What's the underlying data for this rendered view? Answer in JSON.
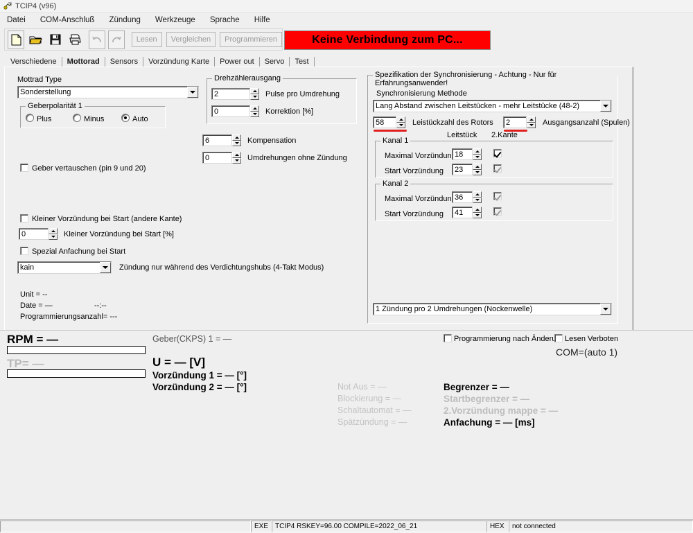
{
  "window": {
    "title": "TCIP4 (v96)",
    "icon": "app-icon"
  },
  "menu": [
    "Datei",
    "COM-Anschluß",
    "Zündung",
    "Werkzeuge",
    "Sprache",
    "Hilfe"
  ],
  "toolbar": {
    "icons": [
      "new-file-icon",
      "open-folder-icon",
      "save-floppy-icon",
      "print-icon",
      "undo-icon",
      "redo-icon"
    ],
    "buttons": [
      {
        "label": "Lesen",
        "enabled": false
      },
      {
        "label": "Vergleichen",
        "enabled": false
      },
      {
        "label": "Programmieren",
        "enabled": false
      }
    ]
  },
  "banner": {
    "text": "Keine Verbindung zum PC...",
    "bg": "#ff0000",
    "fg": "#000000"
  },
  "tabs": [
    {
      "label": "Verschiedene",
      "active": false
    },
    {
      "label": "Mottorad",
      "active": true
    },
    {
      "label": "Sensors",
      "active": false
    },
    {
      "label": "Vorzündung Karte",
      "active": false
    },
    {
      "label": "Power out",
      "active": false
    },
    {
      "label": "Servo",
      "active": false
    },
    {
      "label": "Test",
      "active": false
    }
  ],
  "motorrad": {
    "type_label": "Mottrad Type",
    "type_value": "Sonderstellung",
    "geberpolaritaet": {
      "legend": "Geberpolarität 1",
      "options": [
        "Plus",
        "Minus",
        "Auto"
      ],
      "selected": "Auto"
    },
    "geber_vertauschen": {
      "label": "Geber vertauschen (pin 9 und 20)",
      "checked": false
    },
    "drehzaehler": {
      "legend": "Drehzählerausgang",
      "pulse_value": "2",
      "pulse_label": "Pulse pro Umdrehung",
      "korrektur_value": "0",
      "korrektur_label": "Korrektion [%]"
    },
    "kompensation": {
      "value": "6",
      "label": "Kompensation"
    },
    "umdrehungen": {
      "value": "0",
      "label": "Umdrehungen ohne Zündung"
    },
    "kleiner_vorz_kante": {
      "label": "Kleiner Vorzündung bei Start (andere Kante)",
      "checked": false
    },
    "kleiner_vorz_pct": {
      "value": "0",
      "label": "Kleiner Vorzündung bei Start [%]"
    },
    "spezial_anfachung": {
      "label": "Spezial Anfachung bei Start",
      "checked": false
    },
    "takt_combo_value": "kain",
    "takt_combo_label": "Zündung nur während des Verdichtungshubs (4-Takt Modus)",
    "info": {
      "unit": "Unit = --",
      "date": "Date = —",
      "time": "--:--",
      "prog_count": "Programmierungsanzahl= ---"
    }
  },
  "sync": {
    "legend": "Spezifikation der Synchronisierung - Achtung - Nur für Erfahrungsanwender!",
    "method_label": "Synchronisierung Methode",
    "method_value": "Lang Abstand zwischen Leitstücken - mehr Leitstücke (48-2)",
    "rotor": {
      "value": "58",
      "label": "Leistückzahl des Rotors",
      "marked": true
    },
    "outputs": {
      "value": "2",
      "label": "Ausgangsanzahl (Spulen)",
      "marked": true
    },
    "col_headers": [
      "Leitstück",
      "2.Kante"
    ],
    "kanal1": {
      "legend": "Kanal 1",
      "rows": [
        {
          "label": "Maximal Vorzündung",
          "value": "18",
          "checked": true,
          "enabled": true
        },
        {
          "label": "Start Vorzündung",
          "value": "23",
          "checked": true,
          "enabled": false
        }
      ]
    },
    "kanal2": {
      "legend": "Kanal 2",
      "rows": [
        {
          "label": "Maximal Vorzündung",
          "value": "36",
          "checked": true,
          "enabled": false
        },
        {
          "label": "Start Vorzündung",
          "value": "41",
          "checked": true,
          "enabled": false
        }
      ]
    },
    "bottom_combo_value": "1 Zündung pro 2 Umdrehungen (Nockenwelle)"
  },
  "live": {
    "rpm": "RPM = —",
    "tp": "TP= —",
    "geber_ckps": "Geber(CKPS) 1 = —",
    "voltage": "U = — [V]",
    "vorz1": "Vorzündung 1 = — [°]",
    "vorz2": "Vorzündung 2 = — [°]",
    "left_col": [
      {
        "text": "Not Aus = —",
        "dim": true
      },
      {
        "text": "Blockierung = —",
        "dim": true
      },
      {
        "text": "Schaltautomat = —",
        "dim": true
      },
      {
        "text": "Spätzündung = —",
        "dim": true
      }
    ],
    "right_col": [
      {
        "text": "Begrenzer = —",
        "dim": false
      },
      {
        "text": "Startbegrenzer = —",
        "dim": true
      },
      {
        "text": "2.Vorzündung mappe = —",
        "dim": true
      },
      {
        "text": "Anfachung = — [ms]",
        "dim": false
      }
    ],
    "prog_nach_aenderung": {
      "label": "Programmierung nach Änderur",
      "checked": false
    },
    "lesen_verboten": {
      "label": "Lesen Verboten",
      "checked": false
    },
    "com": "COM=(auto 1)"
  },
  "statusbar": {
    "panel_empty": "",
    "panel_exe": "EXE",
    "panel_info": "TCIP4  RSKEY=96.00  COMPILE=2022_06_21",
    "panel_hex": "HEX",
    "panel_conn": "not connected"
  }
}
